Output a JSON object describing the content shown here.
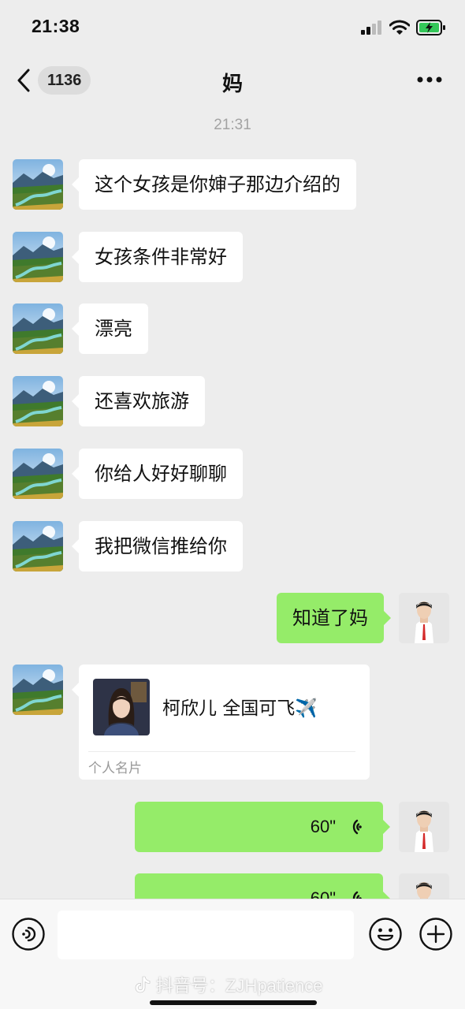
{
  "status_bar": {
    "time": "21:38",
    "icons": [
      "signal-icon",
      "wifi-icon",
      "battery-charging-icon"
    ]
  },
  "nav": {
    "unread_count": "1136",
    "title": "妈",
    "icons": [
      "back-chevron-icon",
      "more-icon"
    ]
  },
  "timestamp": "21:31",
  "messages": [
    {
      "side": "in",
      "text": "这个女孩是你婶子那边介绍的"
    },
    {
      "side": "in",
      "text": "女孩条件非常好"
    },
    {
      "side": "in",
      "text": "漂亮"
    },
    {
      "side": "in",
      "text": "还喜欢旅游"
    },
    {
      "side": "in",
      "text": "你给人好好聊聊"
    },
    {
      "side": "in",
      "text": "我把微信推给你"
    },
    {
      "side": "out",
      "text": "知道了妈"
    }
  ],
  "contact_card": {
    "name": "柯欣儿 全国可飞✈️",
    "footer": "个人名片"
  },
  "voice_messages": [
    {
      "duration": "60\""
    },
    {
      "duration": "60\""
    }
  ],
  "input_bar": {
    "placeholder": "",
    "icons": [
      "voice-toggle-icon",
      "emoji-icon",
      "plus-icon"
    ]
  },
  "watermark": {
    "text": "抖音号：ZJHpatience"
  },
  "colors": {
    "background": "#ededed",
    "incoming_bubble": "#ffffff",
    "outgoing_bubble": "#95ec69",
    "timestamp": "#a3a3a3"
  }
}
